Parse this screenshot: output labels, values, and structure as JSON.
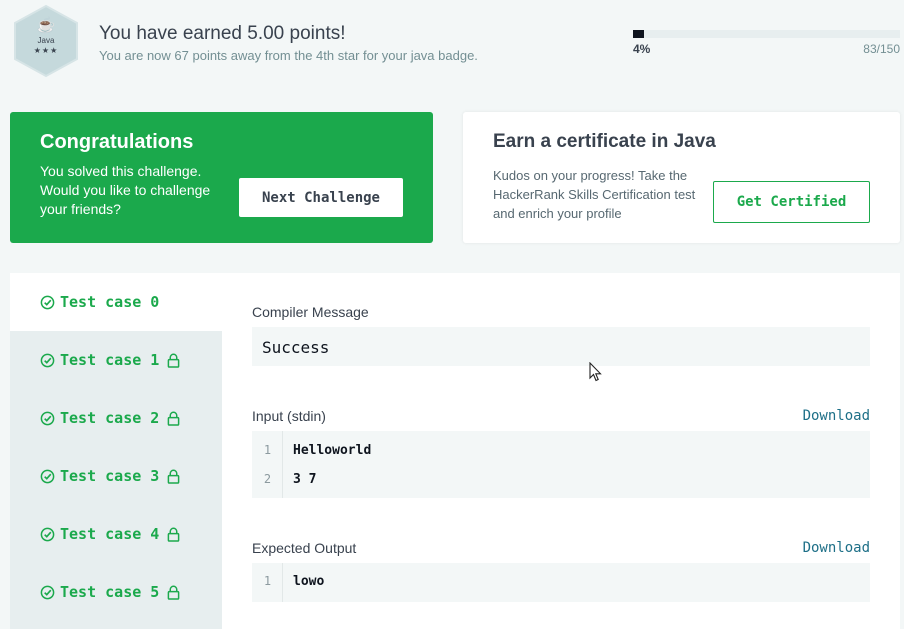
{
  "badge": {
    "icon": "java-cup-icon",
    "language": "Java",
    "stars": "★★★"
  },
  "header": {
    "title": "You have earned 5.00 points!",
    "subtitle": "You are now 67 points away from the 4th star for your java badge.",
    "progress_percent_label": "4%",
    "progress_fraction": 0.04,
    "progress_count": "83/150"
  },
  "congrats": {
    "title": "Congratulations",
    "text": "You solved this challenge. Would you like to challenge your friends?",
    "button_label": "Next Challenge",
    "color": "#1ba94c"
  },
  "certificate": {
    "title": "Earn a certificate in Java",
    "text": "Kudos on your progress! Take the HackerRank Skills Certification test and enrich your profile",
    "button_label": "Get Certified"
  },
  "test_cases": [
    {
      "label": "Test case 0",
      "locked": false,
      "active": true
    },
    {
      "label": "Test case 1",
      "locked": true,
      "active": false
    },
    {
      "label": "Test case 2",
      "locked": true,
      "active": false
    },
    {
      "label": "Test case 3",
      "locked": true,
      "active": false
    },
    {
      "label": "Test case 4",
      "locked": true,
      "active": false
    },
    {
      "label": "Test case 5",
      "locked": true,
      "active": false
    }
  ],
  "compiler": {
    "label": "Compiler Message",
    "message": "Success"
  },
  "input": {
    "label": "Input (stdin)",
    "download_label": "Download",
    "lines": [
      {
        "num": "1",
        "text": "Helloworld"
      },
      {
        "num": "2",
        "text": "3 7"
      }
    ]
  },
  "expected": {
    "label": "Expected Output",
    "download_label": "Download",
    "lines": [
      {
        "num": "1",
        "text": "lowo"
      }
    ]
  }
}
